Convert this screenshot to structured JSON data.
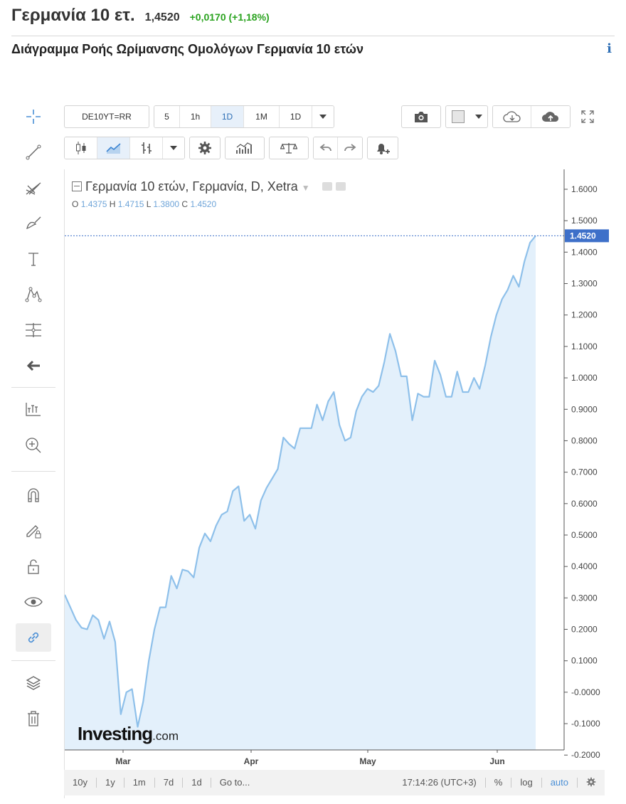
{
  "header": {
    "title": "Γερμανία 10 ετ.",
    "price": "1,4520",
    "change": "+0,0170 (+1,18%)"
  },
  "section": {
    "title": "Διάγραμμα Ροής Ωρίμανσης Ομολόγων Γερμανία 10 ετών",
    "info_icon": "info-icon"
  },
  "toolbar": {
    "symbol": "DE10YT=RR",
    "intervals": [
      "5",
      "1h",
      "1D",
      "1M",
      "1D"
    ],
    "active_interval": "1D"
  },
  "legend": {
    "title": "Γερμανία 10 ετών, Γερμανία, D, Xetra",
    "o_label": "O",
    "o_value": "1.4375",
    "h_label": "H",
    "h_value": "1.4715",
    "l_label": "L",
    "l_value": "1.3800",
    "c_label": "C",
    "c_value": "1.4520"
  },
  "watermark": {
    "main": "Investing",
    "sub": ".com"
  },
  "bottom_bar": {
    "ranges": [
      "10y",
      "1y",
      "1m",
      "7d",
      "1d"
    ],
    "goto": "Go to...",
    "time": "17:14:26 (UTC+3)",
    "percent": "%",
    "log": "log",
    "auto": "auto"
  },
  "colors": {
    "line": "#8ec0ea",
    "fill": "#e3f0fb",
    "last_price_label": "#3e70c9",
    "change_positive": "#2aa31f"
  },
  "chart_data": {
    "type": "area",
    "y_ticks": [
      "1.6000",
      "1.5000",
      "1.4000",
      "1.3000",
      "1.2000",
      "1.1000",
      "1.0000",
      "0.9000",
      "0.8000",
      "0.7000",
      "0.6000",
      "0.5000",
      "0.4000",
      "0.3000",
      "0.2000",
      "0.1000",
      "-0.0000",
      "-0.1000",
      "-0.2000"
    ],
    "ylim": [
      -0.2,
      1.6
    ],
    "x_labels": [
      "Mar",
      "Apr",
      "May",
      "Jun"
    ],
    "last_price": "1.4520",
    "values": [
      0.31,
      0.27,
      0.23,
      0.205,
      0.2,
      0.245,
      0.23,
      0.17,
      0.225,
      0.16,
      -0.07,
      0.0,
      0.01,
      -0.11,
      -0.03,
      0.1,
      0.2,
      0.27,
      0.27,
      0.37,
      0.33,
      0.39,
      0.385,
      0.365,
      0.46,
      0.505,
      0.48,
      0.53,
      0.565,
      0.575,
      0.64,
      0.655,
      0.545,
      0.565,
      0.52,
      0.61,
      0.65,
      0.68,
      0.71,
      0.81,
      0.79,
      0.775,
      0.84,
      0.84,
      0.84,
      0.915,
      0.865,
      0.925,
      0.955,
      0.85,
      0.8,
      0.81,
      0.895,
      0.94,
      0.965,
      0.955,
      0.975,
      1.05,
      1.14,
      1.085,
      1.005,
      1.005,
      0.865,
      0.95,
      0.94,
      0.94,
      1.055,
      1.01,
      0.94,
      0.94,
      1.02,
      0.955,
      0.955,
      1.0,
      0.965,
      1.04,
      1.13,
      1.2,
      1.25,
      1.28,
      1.325,
      1.29,
      1.37,
      1.43,
      1.452
    ]
  }
}
